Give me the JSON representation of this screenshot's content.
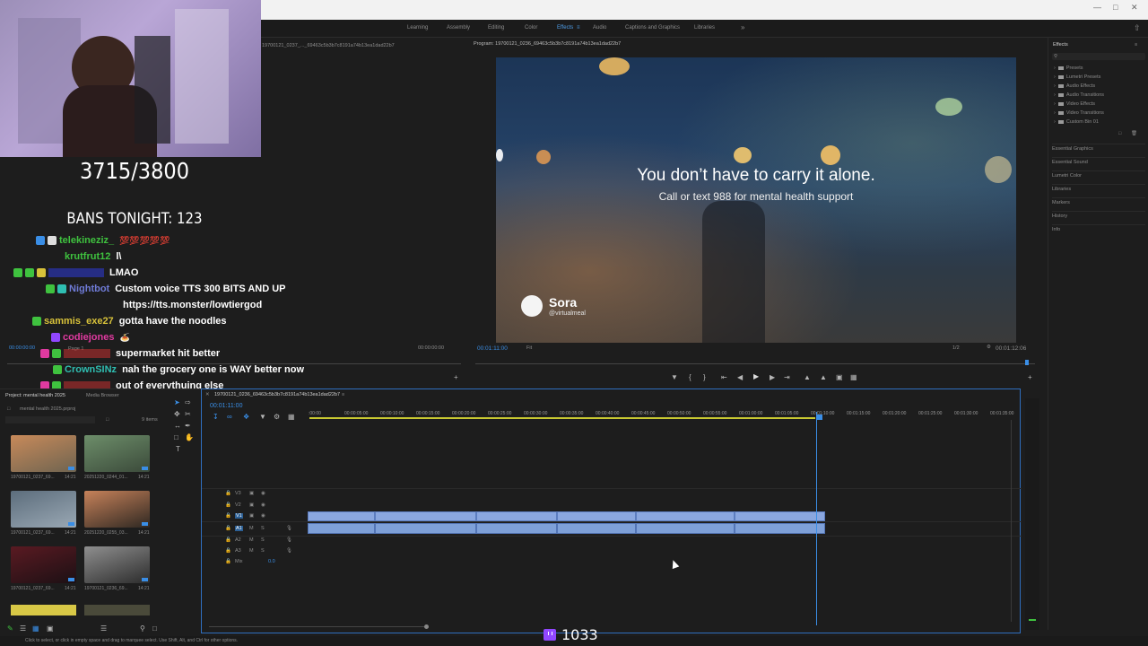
{
  "workspaces": [
    "Learning",
    "Assembly",
    "Editing",
    "Color",
    "Effects",
    "Audio",
    "Captions and Graphics",
    "Libraries"
  ],
  "active_workspace": "Effects",
  "overlay": {
    "counter": "3715/3800",
    "bans": "BANS TONIGHT: 123",
    "viewer_count": "1033"
  },
  "chat": [
    {
      "user": "telekineziz_",
      "message": "💯💯💯💯💯",
      "color": "#3fc23f"
    },
    {
      "user": "krutfrut12",
      "message": "l\\",
      "color": "#3fc23f"
    },
    {
      "user": "",
      "message": "LMAO",
      "color": "#2e3ad8"
    },
    {
      "user": "Nightbot",
      "message": "Custom voice TTS 300 BITS AND UP",
      "color": "#6f7bd6"
    },
    {
      "user": "",
      "message": "https://tts.monster/lowtiergod",
      "color": "#6f7bd6"
    },
    {
      "user": "sammis_exe27",
      "message": "gotta have the noodles",
      "color": "#d8c23a"
    },
    {
      "user": "codiejones",
      "message": "🍝",
      "color": "#e03aa0"
    },
    {
      "user": "",
      "message": "supermarket hit better",
      "color": "#c43030"
    },
    {
      "user": "CrownSINz",
      "message": "nah the grocery one is WAY better now",
      "color": "#2fbfb2"
    },
    {
      "user": "",
      "message": "out of everythuing else",
      "color": "#c43030"
    }
  ],
  "source_monitor": {
    "clip_name": "19700121_0237_..._69463c5b3b7c8191a74b13ea1dad22b7",
    "timecode_left": "00:00:00:00",
    "timecode_right": "00:00:00:00",
    "page": "Page 1"
  },
  "program_monitor": {
    "title": "Program: 19700121_0236_69463c5b3b7c8191a74b13ea1dad22b7",
    "timecode": "00:01:11:00",
    "fit": "Fit",
    "ratio": "1/2",
    "duration": "00:01:12:06",
    "video_headline": "You don’t have to carry it alone.",
    "video_subtitle": "Call or text 988 for mental health support",
    "brand_name": "Sora",
    "brand_handle": "@virtualmeal"
  },
  "effects_panel": {
    "title": "Effects",
    "folders": [
      "Presets",
      "Lumetri Presets",
      "Audio Effects",
      "Audio Transitions",
      "Video Effects",
      "Video Transitions",
      "Custom Bin 01"
    ],
    "panels": [
      "Essential Graphics",
      "Essential Sound",
      "Lumetri Color",
      "Libraries",
      "Markers",
      "History",
      "Info"
    ]
  },
  "project_panel": {
    "tabs": [
      "Project: mental health 2025",
      "Media Browser"
    ],
    "file": "mental health 2025.prproj",
    "item_count": "9 items",
    "thumbs": [
      {
        "name": "19700121_0237_69...",
        "dur": "14:21",
        "colors": [
          "#c88a5a",
          "#6f6450"
        ]
      },
      {
        "name": "20251220_0244_01...",
        "dur": "14:21",
        "colors": [
          "#6d8e6a",
          "#3b4a3a"
        ]
      },
      {
        "name": "19700121_0237_69...",
        "dur": "14:21",
        "colors": [
          "#5c6d7c",
          "#9aa8b4"
        ]
      },
      {
        "name": "20251220_0255_03...",
        "dur": "14:21",
        "colors": [
          "#c7825a",
          "#2f2822"
        ]
      },
      {
        "name": "19700121_0237_69...",
        "dur": "14:21",
        "colors": [
          "#5a1a22",
          "#1c1014"
        ]
      },
      {
        "name": "19700121_0236_69...",
        "dur": "14:21",
        "colors": [
          "#8f8f8f",
          "#2c2c2c"
        ]
      }
    ]
  },
  "timeline": {
    "sequence_name": "19700121_0236_69463c5b3b7c8191a74b13ea1dad22b7",
    "timecode": "00:01:11:00",
    "ruler": [
      ":00:00",
      "00:00:05:00",
      "00:00:10:00",
      "00:00:15:00",
      "00:00:20:00",
      "00:00:25:00",
      "00:00:30:00",
      "00:00:35:00",
      "00:00:40:00",
      "00:00:45:00",
      "00:00:50:00",
      "00:00:55:00",
      "00:01:00:00",
      "00:01:05:00",
      "00:01:10:00",
      "00:01:15:00",
      "00:01:20:00",
      "00:01:25:00",
      "00:01:30:00",
      "00:01:35:00"
    ],
    "tracks": [
      "V3",
      "V2",
      "V1",
      "A1",
      "A2",
      "A3",
      "Mix"
    ],
    "mix_value": "0.0"
  },
  "status_text": "Click to select, or click in empty space and drag to marquee select. Use Shift, Alt, and Ctrl for other options."
}
